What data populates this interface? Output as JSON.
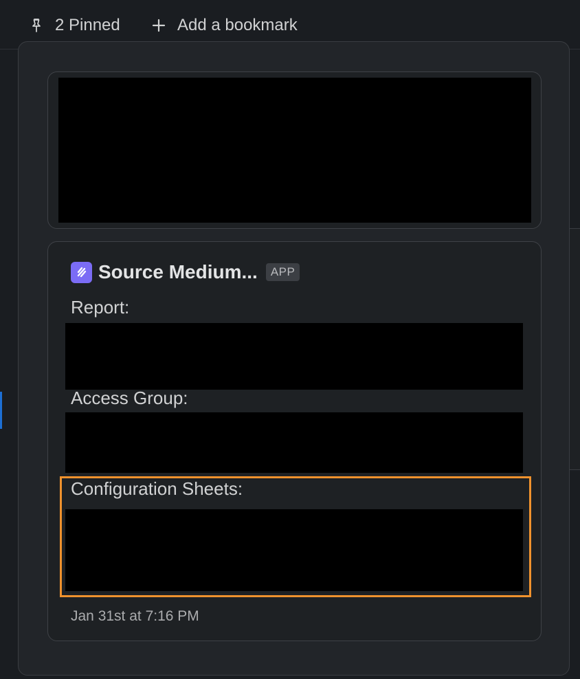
{
  "topbar": {
    "pinned_label": "2 Pinned",
    "bookmark_label": "Add a bookmark"
  },
  "message": {
    "app_name": "Source Medium...",
    "app_badge": "APP",
    "fields": [
      {
        "label": "Report:"
      },
      {
        "label": "Access Group:"
      },
      {
        "label": "Configuration Sheets:"
      }
    ],
    "timestamp": "Jan 31st at 7:16 PM"
  },
  "colors": {
    "highlight": "#f0922d",
    "app_logo": "#7b6cf5",
    "selection_line": "#1d6fd3"
  },
  "icons": [
    "pin-icon",
    "plus-icon",
    "app-logo-icon"
  ]
}
